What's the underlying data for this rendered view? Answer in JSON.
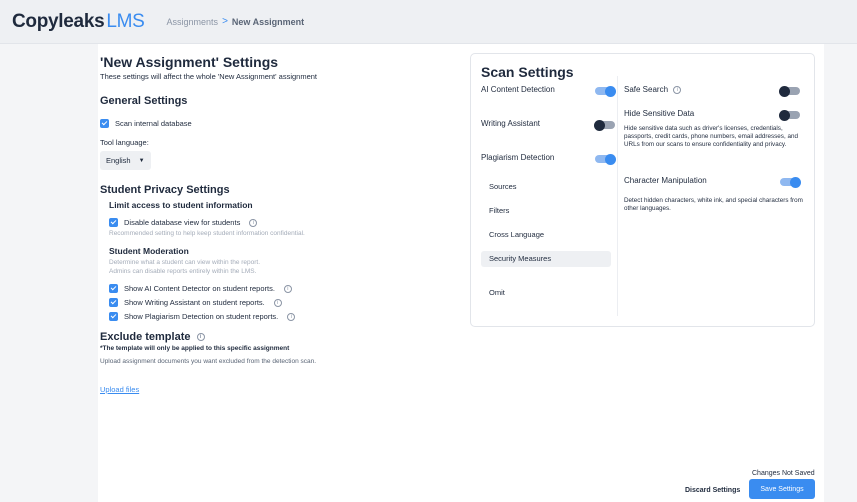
{
  "header": {
    "logo_brand": "Copyleaks",
    "logo_suffix": "LMS",
    "breadcrumb": {
      "parent": "Assignments",
      "separator": ">",
      "current": "New Assignment"
    }
  },
  "settings": {
    "title": "'New Assignment' Settings",
    "subtitle": "These settings will affect the whole 'New Assignment' assignment",
    "general_heading": "General Settings",
    "scan_internal_label": "Scan internal database",
    "tool_language_label": "Tool language:",
    "tool_language_value": "English",
    "privacy_heading": "Student Privacy Settings",
    "limit_access_heading": "Limit access to student information",
    "disable_db_label": "Disable database view for students",
    "disable_db_hint": "Recommended setting to help keep student information confidential.",
    "moderation_heading": "Student Moderation",
    "moderation_hint_1": "Determine what a student can view within the report.",
    "moderation_hint_2": "Admins can disable reports entirely within the LMS.",
    "moderation_items": [
      "Show AI Content Detector on student reports.",
      "Show Writing Assistant on student reports.",
      "Show Plagiarism Detection on student reports."
    ],
    "exclude_heading": "Exclude template",
    "exclude_note": "*The template will only be applied to this specific assignment",
    "exclude_desc": "Upload assignment documents you want excluded from the detection scan.",
    "upload_link": "Upload files"
  },
  "scan": {
    "title": "Scan Settings",
    "left_items": [
      {
        "label": "AI Content Detection",
        "on": true
      },
      {
        "label": "Writing Assistant",
        "on": false
      },
      {
        "label": "Plagiarism Detection",
        "on": true
      }
    ],
    "sub_items": [
      "Sources",
      "Filters",
      "Cross Language",
      "Security Measures",
      "Omit"
    ],
    "active_sub_item": "Security Measures",
    "safe_search_label": "Safe Search",
    "safe_search_on": false,
    "hide_sensitive_label": "Hide Sensitive Data",
    "hide_sensitive_on": false,
    "hide_sensitive_desc": "Hide sensitive data such as driver's licenses, credentials, passports, credit cards, phone numbers, email addresses, and URLs from our scans to ensure confidentiality and privacy.",
    "char_manip_label": "Character Manipulation",
    "char_manip_on": true,
    "char_manip_desc": "Detect hidden characters, white ink, and special characters from other languages."
  },
  "footer": {
    "status": "Changes Not Saved",
    "discard_label": "Discard Settings",
    "save_label": "Save Settings"
  },
  "colors": {
    "accent": "#3a8cf0",
    "text": "#1f2a3d"
  }
}
